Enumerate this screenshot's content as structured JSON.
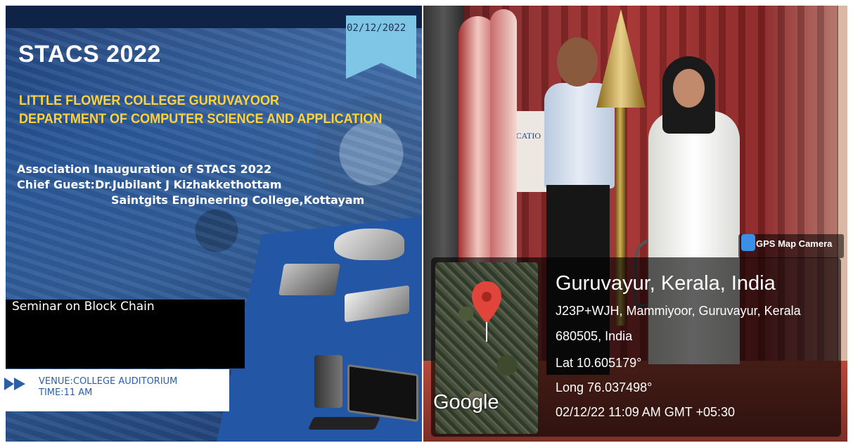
{
  "poster": {
    "date": "02/12/2022",
    "title": "STACS 2022",
    "college_line_1": "LITTLE FLOWER COLLEGE GURUVAYOOR",
    "college_line_2": "DEPARTMENT OF COMPUTER  SCIENCE AND APPLICATION",
    "event_line_1": "Association Inauguration of STACS 2022",
    "event_line_2": "Chief Guest:Dr.Jubilant J Kizhakkethottam",
    "event_line_3": "Saintgits Engineering College,Kottayam",
    "seminar": "Seminar on Block Chain",
    "venue": "VENUE:COLLEGE AUDITORIUM",
    "time": "TIME:11 AM",
    "accent_color": "#ffd23a"
  },
  "photo": {
    "banner_text": "PPLICATIO",
    "gps_app_label": "GPS Map Camera",
    "map_logo": "Google",
    "location": "Guruvayur, Kerala, India",
    "address_line_1": "J23P+WJH, Mammiyoor, Guruvayur, Kerala",
    "address_line_2": "680505, India",
    "latitude": "Lat 10.605179°",
    "longitude": "Long 76.037498°",
    "timestamp": "02/12/22 11:09 AM GMT +05:30",
    "pin_color": "#e0443a"
  }
}
